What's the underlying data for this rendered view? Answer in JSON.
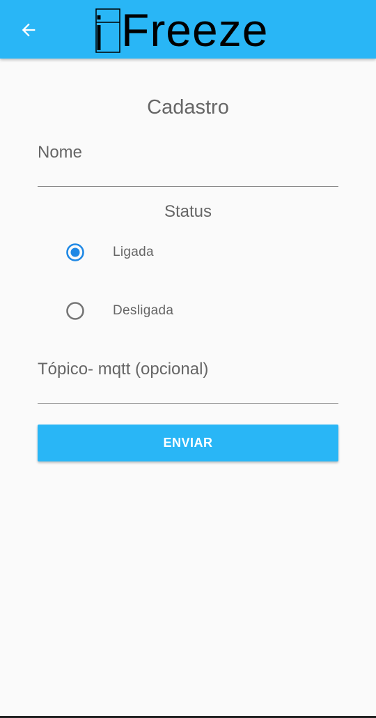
{
  "appbar": {
    "back_icon": "arrow-left-icon",
    "logo_text": "Freeze",
    "logo_prefix": "i",
    "background_color": "#29b6f6"
  },
  "form": {
    "title": "Cadastro",
    "nome_label": "Nome",
    "status_label": "Status",
    "status_options": [
      {
        "label": "Ligada",
        "selected": true
      },
      {
        "label": "Desligada",
        "selected": false
      }
    ],
    "topico_label": "Tópico- mqtt (opcional)",
    "submit_label": "ENVIAR"
  },
  "colors": {
    "accent": "#29b6f6",
    "radio_selected": "#1e88e5",
    "radio_unselected": "#757575",
    "text": "#666666"
  }
}
